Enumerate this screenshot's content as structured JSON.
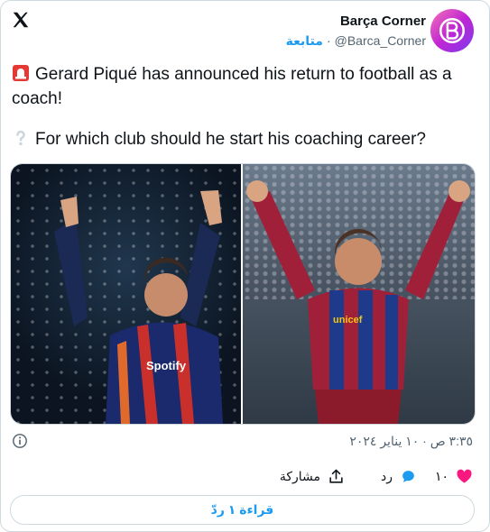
{
  "header": {
    "account_name": "Barça Corner",
    "account_handle": "@Barca_Corner",
    "follow_label": "متابعة",
    "separator": "·"
  },
  "tweet": {
    "line1": "Gerard Piqué has announced his return to football as a coach!",
    "line2": "For which club should he start his coaching career?",
    "emoji1": "rotating-light-icon",
    "emoji2": "white-question-mark-icon"
  },
  "media": {
    "count": 2,
    "left_alt": "Piqué raising arms in stadium",
    "right_alt": "Piqué celebrating in Barcelona shirt"
  },
  "meta": {
    "timestamp": "٣:٣٥ ص · ١٠ يناير ٢٠٢٤"
  },
  "actions": {
    "like_count": "١٠",
    "reply_label": "رد",
    "share_label": "مشاركة"
  },
  "read_replies": "قراءة ١ ردّ",
  "colors": {
    "accent": "#1d9bf0",
    "like": "#f91880",
    "text": "#0f1419",
    "muted": "#536471",
    "border": "#cfd9de"
  }
}
